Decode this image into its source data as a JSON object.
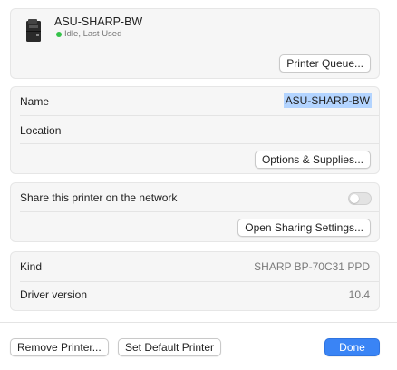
{
  "printer": {
    "name": "ASU-SHARP-BW",
    "status": "Idle, Last Used",
    "status_color": "#35c24a",
    "icon": "printer-icon"
  },
  "buttons": {
    "printer_queue": "Printer Queue...",
    "options_supplies": "Options & Supplies...",
    "open_sharing": "Open Sharing Settings...",
    "remove_printer": "Remove Printer...",
    "set_default": "Set Default Printer",
    "done": "Done"
  },
  "details": {
    "name_label": "Name",
    "name_value": "ASU-SHARP-BW",
    "location_label": "Location",
    "location_value": ""
  },
  "sharing": {
    "label": "Share this printer on the network",
    "enabled": false
  },
  "info": {
    "kind_label": "Kind",
    "kind_value": "SHARP BP-70C31 PPD",
    "driver_label": "Driver version",
    "driver_value": "10.4"
  },
  "colors": {
    "accent": "#3a84f5",
    "selection": "#b3d4ff"
  }
}
